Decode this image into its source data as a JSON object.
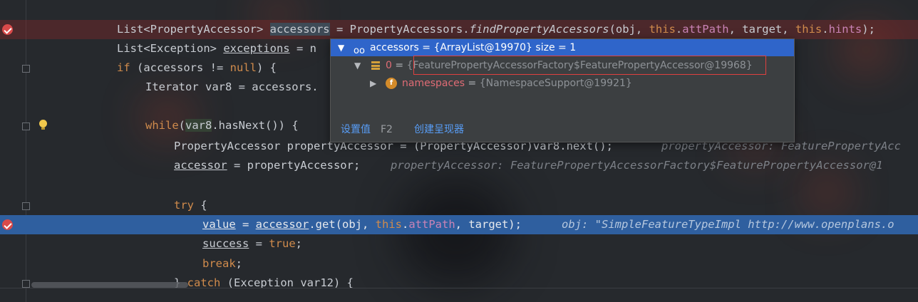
{
  "code": {
    "line1": {
      "t1": "List<PropertyAccessor> ",
      "var": "accessors",
      "t2": " = PropertyAccessors.",
      "method": "findPropertyAccessors",
      "t3": "(obj, ",
      "kw_this": "this",
      "t4": ".",
      "fld1": "attPath",
      "t5": ", target, ",
      "kw_this2": "this",
      "t6": ".",
      "fld2": "hints",
      "t7": ");"
    },
    "line2": {
      "t1": "List<Exception> ",
      "var": "exceptions",
      "t2": " = n"
    },
    "line3": {
      "kw_if": "if",
      "t1": " (accessors != ",
      "kw_null": "null",
      "t2": ") {"
    },
    "line4": {
      "t1": "Iterator var8 = accessors."
    },
    "line5": {
      "kw_while": "while",
      "t1": "(",
      "var": "var8",
      "t2": ".hasNext()) {"
    },
    "line6": {
      "t1": "PropertyAccessor propertyAccessor = (PropertyAccessor)",
      "var": "var8",
      "t2": ".next();",
      "hint": "propertyAccessor: FeaturePropertyAcc"
    },
    "line7": {
      "var": "accessor",
      "t1": " = propertyAccessor;",
      "hint": "propertyAccessor: FeaturePropertyAccessorFactory$FeaturePropertyAccessor@1"
    },
    "line8": {
      "kw_try": "try",
      "t1": " {"
    },
    "line9": {
      "var1": "value",
      "t1": " = ",
      "var2": "accessor",
      "t2": ".get(obj, ",
      "kw_this": "this",
      "t3": ".",
      "fld": "attPath",
      "t4": ", target);",
      "hint": "obj: \"SimpleFeatureTypeImpl http://www.openplans.o"
    },
    "line10": {
      "var": "success",
      "t1": " = ",
      "kw_true": "true",
      "t2": ";"
    },
    "line11": {
      "kw_break": "break",
      "t1": ";"
    },
    "line12": {
      "t1": "} ",
      "kw_catch": "catch",
      "t2": " (Exception var12) {"
    }
  },
  "popup": {
    "root": {
      "name": "accessors",
      "eq": " = ",
      "value": "{ArrayList@19970}  size = 1"
    },
    "item0": {
      "name": "0",
      "eq": " = ",
      "value": "{FeaturePropertyAccessorFactory$FeaturePropertyAccessor@19968}"
    },
    "field": {
      "icon_letter": "f",
      "name": "namespaces",
      "eq": " = ",
      "value": "{NamespaceSupport@19921}"
    },
    "actions": {
      "set_value": "设置值",
      "set_value_key": "F2",
      "create_renderer": "创建呈现器"
    }
  },
  "icons": {
    "breakpoint": "breakpoint-icon",
    "fold": "fold-icon",
    "bulb": "lightbulb-icon",
    "watch": "glasses-icon",
    "array": "array-icon",
    "field": "field-icon"
  },
  "colors": {
    "keyword": "#d08b4c",
    "field": "#c983b6",
    "exec_line": "#2f5f9f",
    "selection": "#2f65ca",
    "link": "#589df6",
    "highlight_box": "#e04040"
  }
}
